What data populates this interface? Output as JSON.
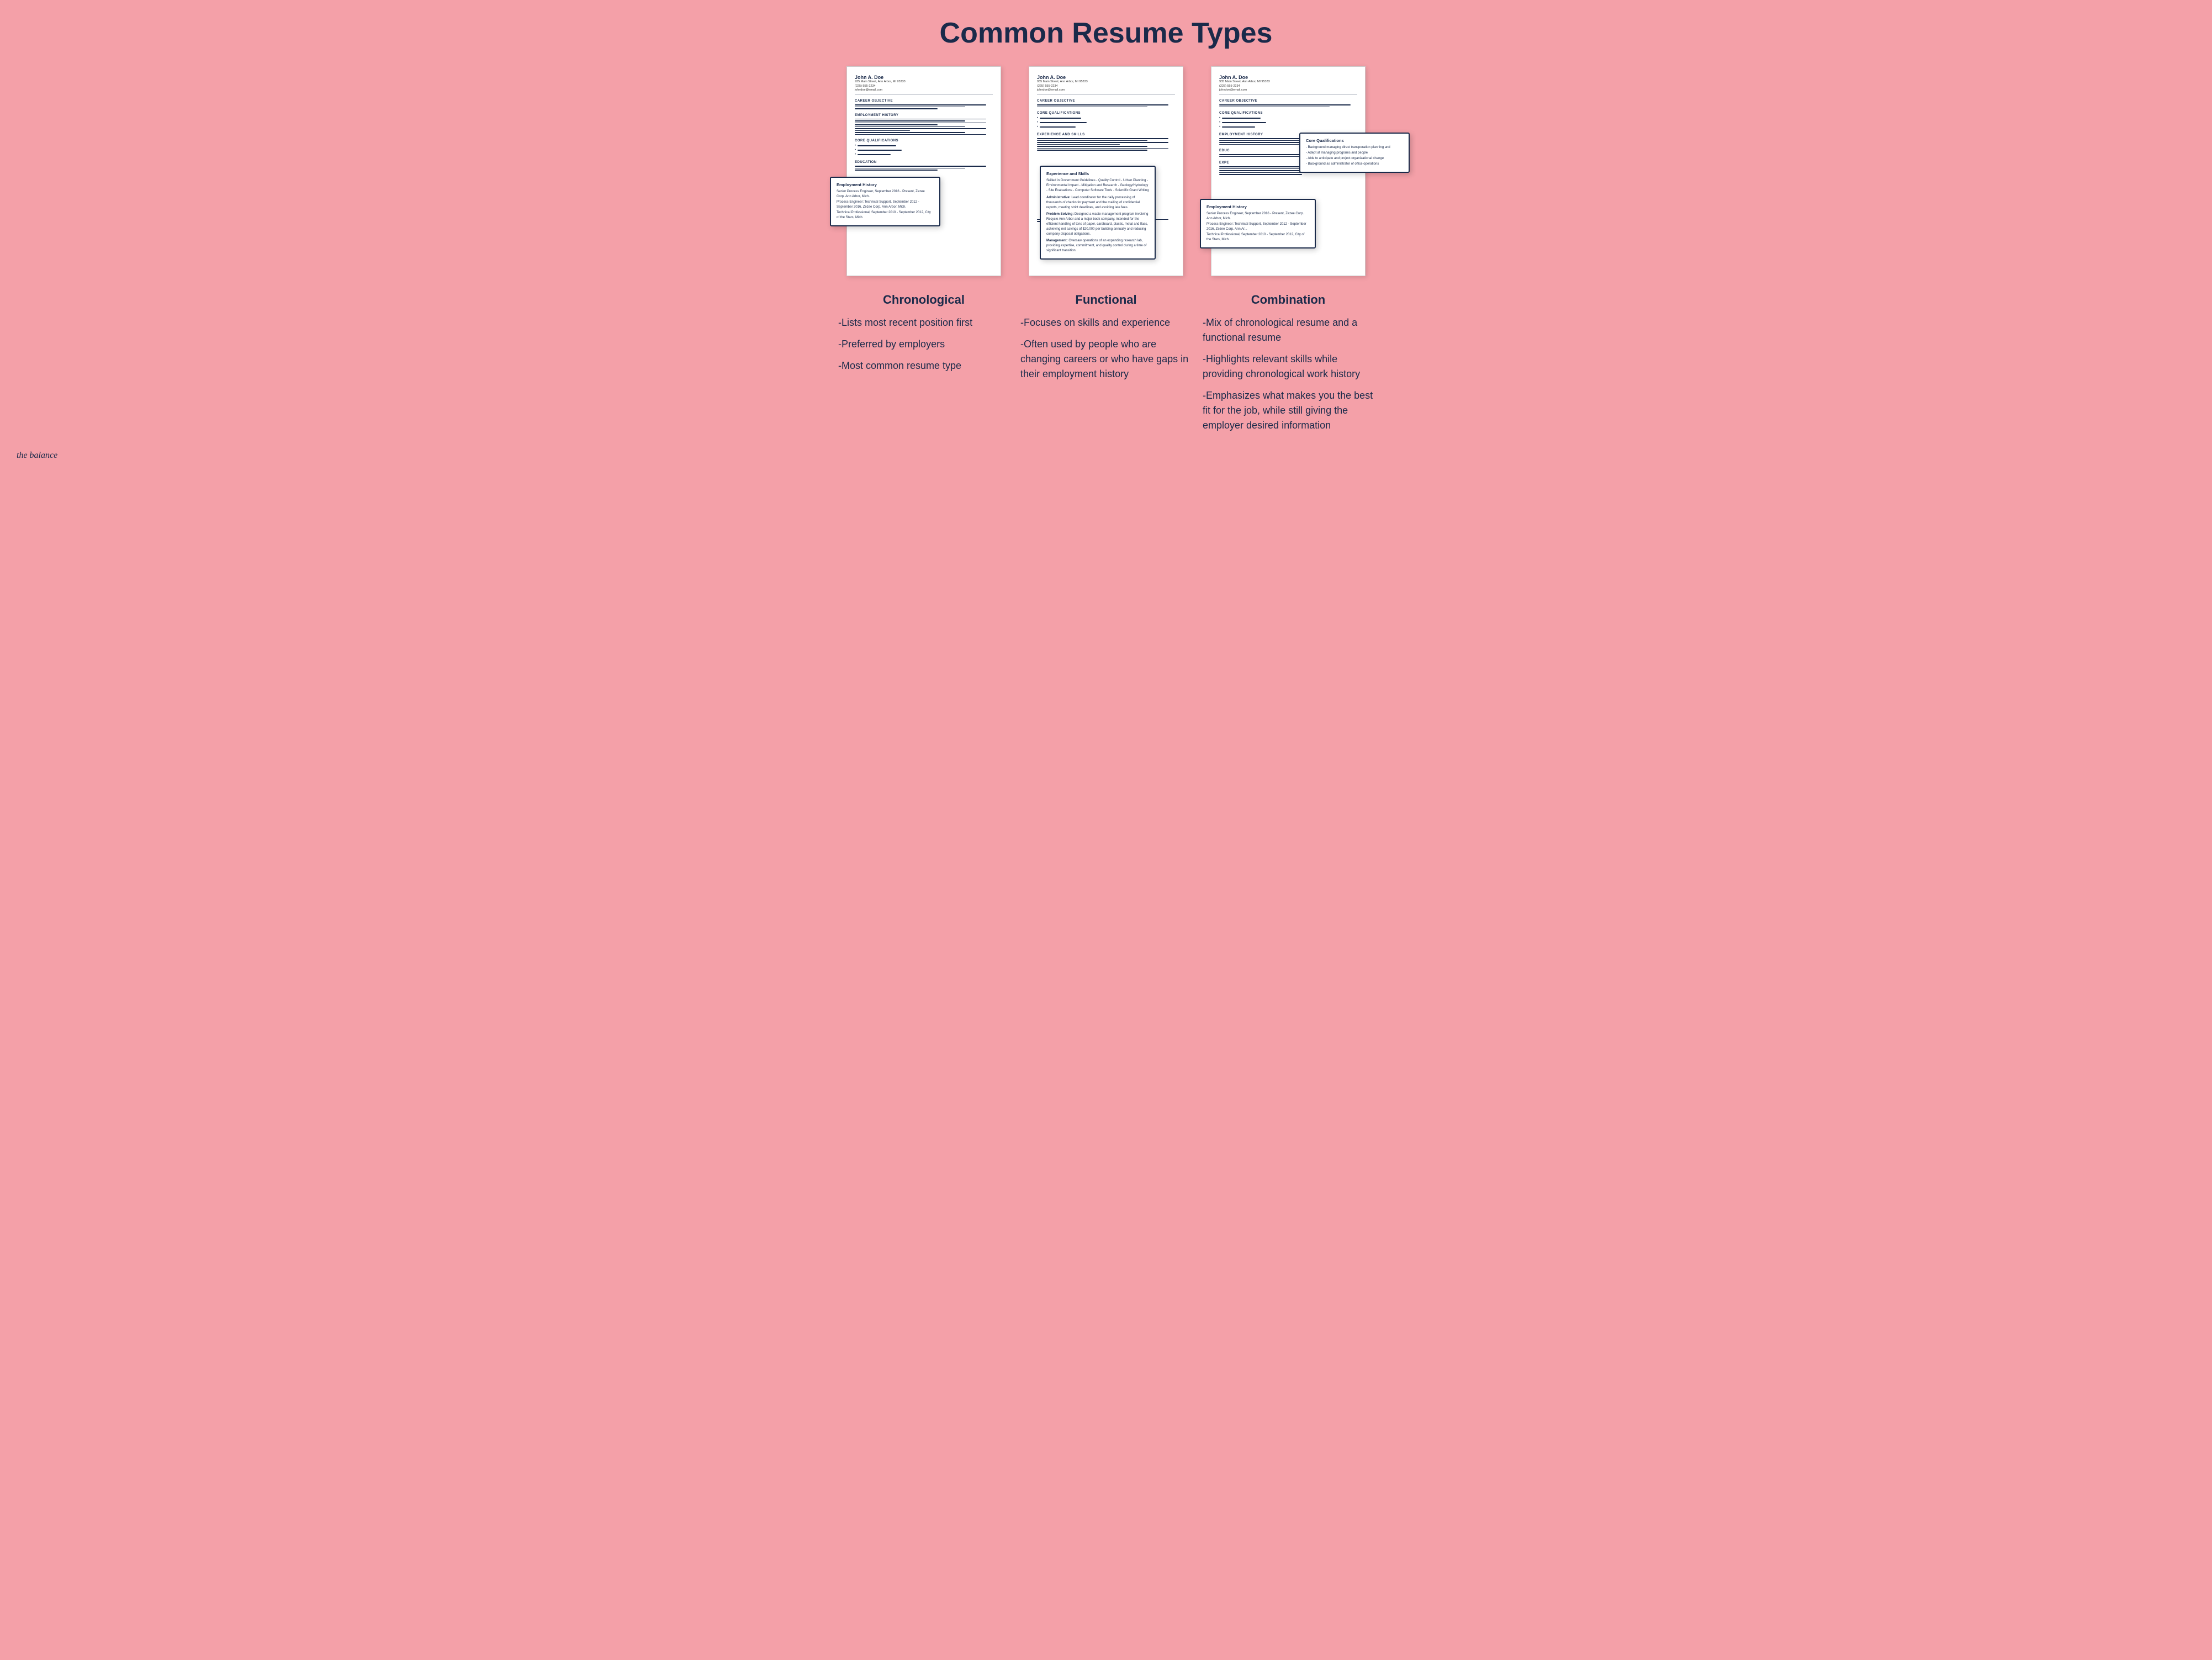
{
  "page": {
    "title": "Common Resume Types",
    "background_color": "#f4a0a8"
  },
  "resume_person": {
    "name": "John A. Doe",
    "address": "935 Main Street, Ann Arbor, MI 95333",
    "phone": "(225) 555-2234",
    "email": "johndoe@email.com"
  },
  "callouts": {
    "employment_history": {
      "title": "Employment History",
      "lines": [
        "Senior Process Engineer, September 2016 - Present, Zezee Corp. Ann Arbor, Mich.",
        "Process Engineer: Technical Support, September 2012 - September 2016, Zezee Corp. Ann Arbor, Mich.",
        "Technical Professional, September 2010 - September 2012, City of the Stars, Mich."
      ]
    },
    "experience_skills": {
      "title": "Experience and Skills",
      "intro": "Skilled in Government Guidelines - Quality Control - Urban Planning - Environmental Impact - Mitigation and Research - Geology/Hydrology - Site Evaluations - Computer Software Tools - Scientific Grant Writing",
      "items": [
        {
          "label": "Administrative:",
          "text": "Lead coordinator for the daily processing of thousands of checks for payment and the mailing of confidential reports, meeting strict deadlines, and avoiding late fees."
        },
        {
          "label": "Problem Solving:",
          "text": "Designed a waste management program involving Recycle Ann Arbor and a major book company, intended for the efficient handling of tons of paper, cardboard, plastic, metal and flass, achieving net savings of $20,000 per building annually and reducing company disposal obligations."
        },
        {
          "label": "Management:",
          "text": "Oversaw operations of an expanding research lab, providing expertise, commitment, and quality control during a time of significant transition."
        }
      ]
    },
    "core_qualifications": {
      "title": "Core Qualifications",
      "lines": [
        "- Background managing direct transporation planning and",
        "- Adept at managing programs and people",
        "- Able to anticipate and project organizational change",
        "- Background as administrator of office operations"
      ]
    },
    "employment_history_combo": {
      "title": "Employment History",
      "lines": [
        "Senior Process Engineer, September 2016 - Present, Zezee Corp. Ann Arbor, Mich.",
        "Process Engineer: Technical Support, September 2012 - September 2016, Zezee Corp. Ann Ar...",
        "Technical Professional, September 2010 - September 2012, City of the Stars, Mich."
      ]
    }
  },
  "descriptions": {
    "chronological": {
      "title": "Chronological",
      "items": [
        "-Lists most recent position first",
        "-Preferred by employers",
        "-Most common resume type"
      ]
    },
    "functional": {
      "title": "Functional",
      "items": [
        "-Focuses on skills and experience",
        "-Often used by people who are changing careers or who have gaps in their employment history"
      ]
    },
    "combination": {
      "title": "Combination",
      "items": [
        "-Mix of chronological resume and a functional resume",
        "-Highlights relevant skills while providing chronological work history",
        "-Emphasizes what makes you the best fit for the job, while still giving the employer desired information"
      ]
    }
  },
  "watermark": "the balance",
  "sections": {
    "career_objective": "CAREER OBJECTIVE",
    "employment_history": "EMPLOYMENT HISTORY",
    "core_qualifications": "CORE QUALIFICATIONS",
    "education": "EDUCATION",
    "experience_and_skills": "EXPERIENCE AND SKILLS"
  }
}
